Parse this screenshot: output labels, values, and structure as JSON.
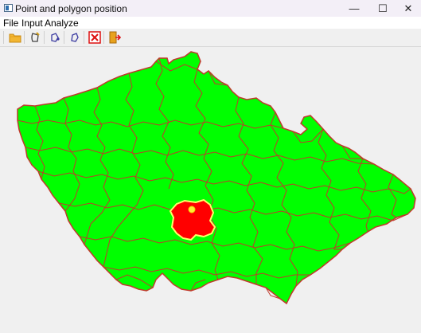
{
  "window": {
    "title": "Point and polygon position",
    "controls": {
      "minimize": "—",
      "maximize": "☐",
      "close": "✕"
    }
  },
  "menu": {
    "items": [
      {
        "label": "File"
      },
      {
        "label": "Input"
      },
      {
        "label": "Analyze"
      }
    ]
  },
  "toolbar": {
    "buttons": [
      {
        "icon": "open-folder-icon"
      },
      {
        "icon": "pen-polygon-icon"
      },
      {
        "icon": "point-icon"
      },
      {
        "icon": "polygon-icon"
      },
      {
        "icon": "clear-icon"
      },
      {
        "icon": "exit-icon"
      }
    ]
  },
  "map": {
    "fill_color": "#00ff00",
    "border_color": "#c0392b",
    "highlight_color": "#ff0000",
    "highlight_border_color": "#ffff66",
    "point_color": "#ffee33"
  }
}
